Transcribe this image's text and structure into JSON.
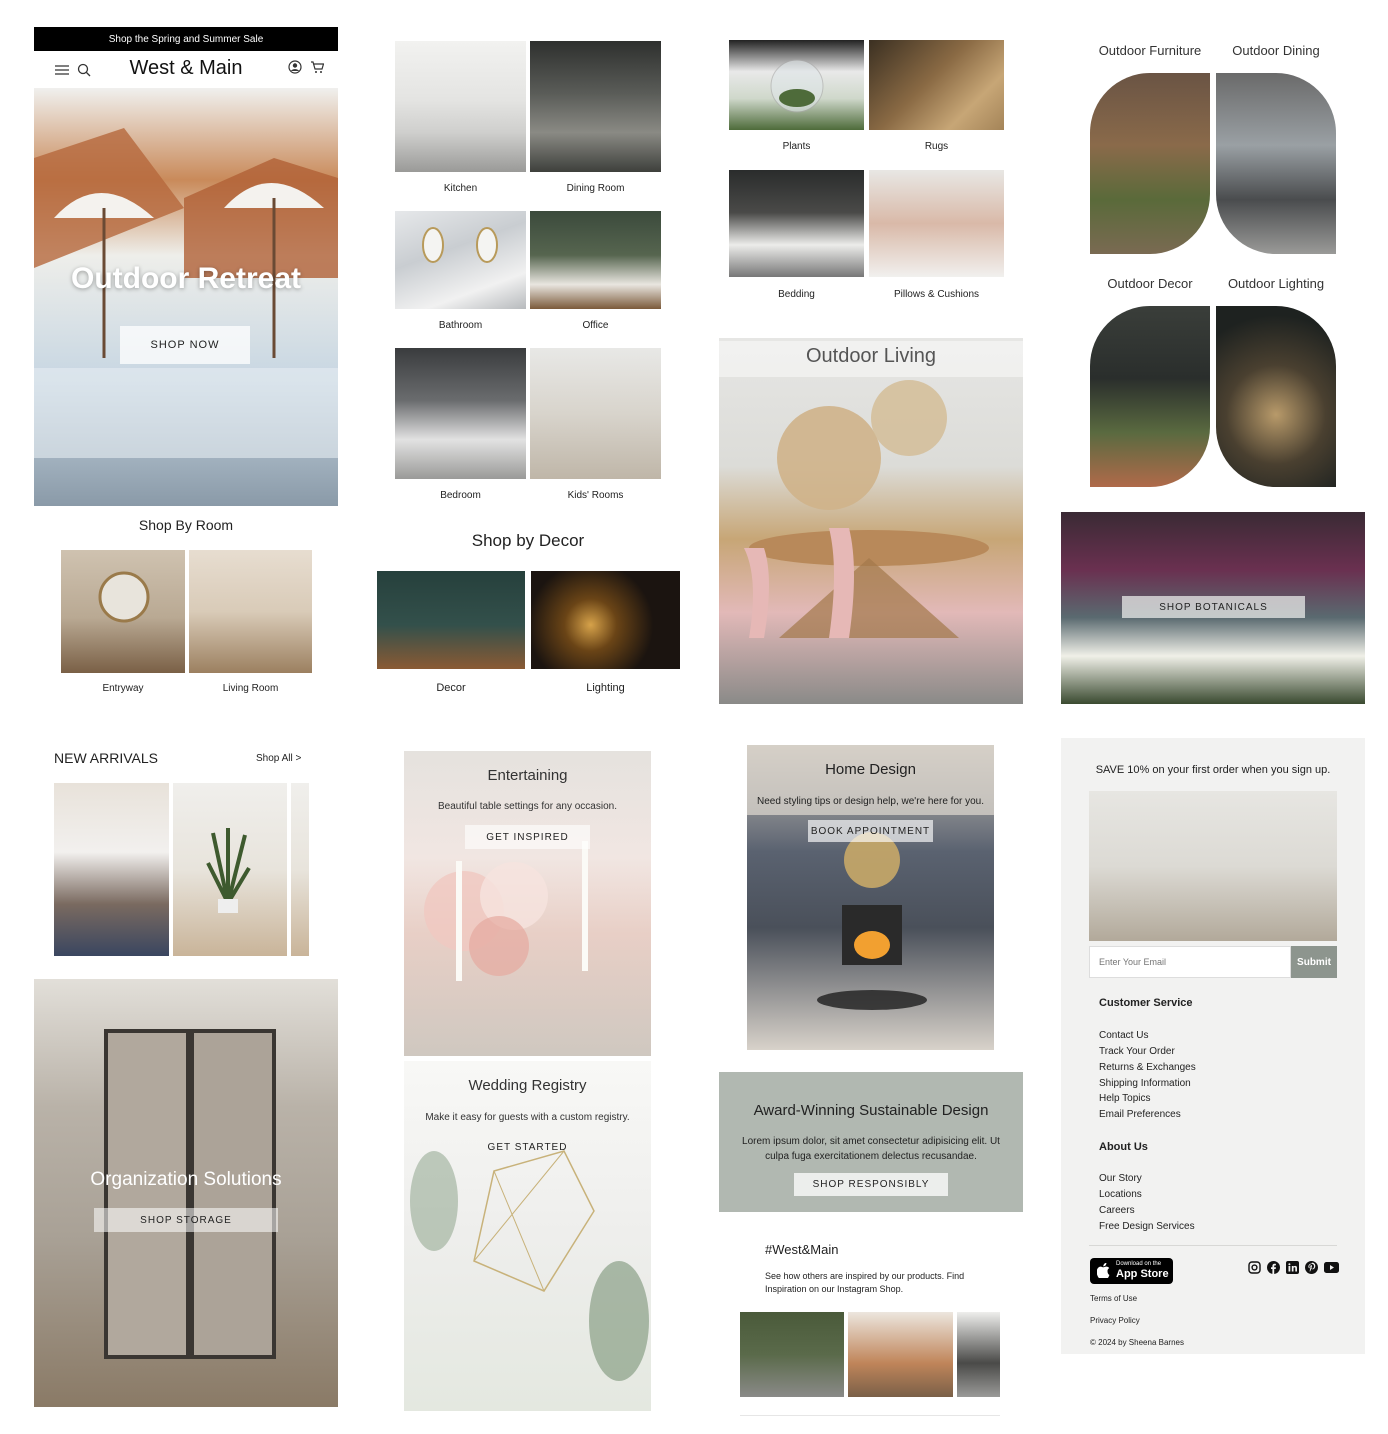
{
  "colors": {
    "black": "#000000",
    "sage": "#b1b8b1",
    "submit_bg": "#8d958e",
    "panel": "#f2f2f1"
  },
  "col1": {
    "promo_bar": "Shop the Spring and Summer Sale",
    "brand": "West & Main",
    "icons": [
      "menu-icon",
      "search-icon",
      "user-icon",
      "cart-icon"
    ],
    "hero_title": "Outdoor Retreat",
    "hero_button": "SHOP NOW",
    "shop_by_room": "Shop By Room",
    "rooms": [
      "Entryway",
      "Living Room"
    ],
    "new_arrivals": "NEW ARRIVALS",
    "shop_all": "Shop All >",
    "org_title": "Organization Solutions",
    "org_button": "SHOP STORAGE"
  },
  "col2": {
    "rooms": [
      "Kitchen",
      "Dining Room",
      "Bathroom",
      "Office",
      "Bedroom",
      "Kids' Rooms"
    ],
    "shop_by_decor": "Shop by Decor",
    "decor": [
      "Decor",
      "Lighting"
    ],
    "entertaining_title": "Entertaining",
    "entertaining_text": "Beautiful table settings for any occasion.",
    "entertaining_button": "GET INSPIRED",
    "wedding_title": "Wedding Registry",
    "wedding_text": "Make it easy for guests with a custom registry.",
    "wedding_button": "GET STARTED"
  },
  "col3": {
    "categories": [
      "Plants",
      "Rugs",
      "Bedding",
      "Pillows & Cushions"
    ],
    "outdoor_living": "Outdoor Living",
    "home_design_title": "Home Design",
    "home_design_text": "Need styling tips or design help, we're here for you.",
    "home_design_button": "BOOK APPOINTMENT",
    "award_title": "Award-Winning Sustainable Design",
    "award_text": "Lorem ipsum dolor, sit amet consectetur adipisicing elit. Ut culpa fuga exercitationem delectus recusandae.",
    "award_button": "SHOP RESPONSIBLY",
    "hashtag": "#West&Main",
    "hashtag_text": "See how others are inspired by our products.   Find Inspiration on our Instagram Shop."
  },
  "col4": {
    "outdoor": [
      "Outdoor Furniture",
      "Outdoor Dining",
      "Outdoor Decor",
      "Outdoor Lighting"
    ],
    "botanicals_button": "SHOP BOTANICALS",
    "signup_text": "SAVE 10% on your first order when you sign up.",
    "email_placeholder": "Enter Your Email",
    "submit": "Submit",
    "customer_service_heading": "Customer Service",
    "customer_service": [
      "Contact Us",
      "Track Your Order",
      "Returns & Exchanges",
      "Shipping Information",
      "Help Topics",
      "Email Preferences"
    ],
    "about_heading": "About Us",
    "about": [
      "Our Story",
      "Locations",
      "Careers",
      "Free Design Services"
    ],
    "app_store_small": "Download on the",
    "app_store": "App Store",
    "social": [
      "instagram-icon",
      "facebook-icon",
      "linkedin-icon",
      "pinterest-icon",
      "youtube-icon"
    ],
    "terms": "Terms of Use",
    "privacy": "Privacy Policy",
    "copyright": "© 2024 by Sheena Barnes"
  }
}
